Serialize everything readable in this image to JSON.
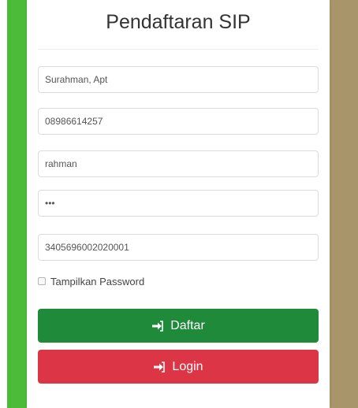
{
  "page": {
    "title": "Pendaftaran SIP"
  },
  "form": {
    "fields": [
      {
        "name": "nama",
        "value": "Surahman, Apt"
      },
      {
        "name": "telepon",
        "value": "08986614257"
      },
      {
        "name": "username",
        "value": "rahman"
      },
      {
        "name": "password",
        "value": "•••"
      },
      {
        "name": "nik",
        "value": "3405696002020001"
      }
    ],
    "show_password_label": "Tampilkan Password",
    "show_password_checked": false
  },
  "buttons": {
    "daftar": "Daftar",
    "login": "Login"
  },
  "colors": {
    "left_strip": "#4dbb3a",
    "right_strip": "#a8966a",
    "daftar_bg": "#1e8a3a",
    "login_bg": "#dc3545"
  },
  "icons": {
    "button_icon": "sign-in-icon"
  }
}
